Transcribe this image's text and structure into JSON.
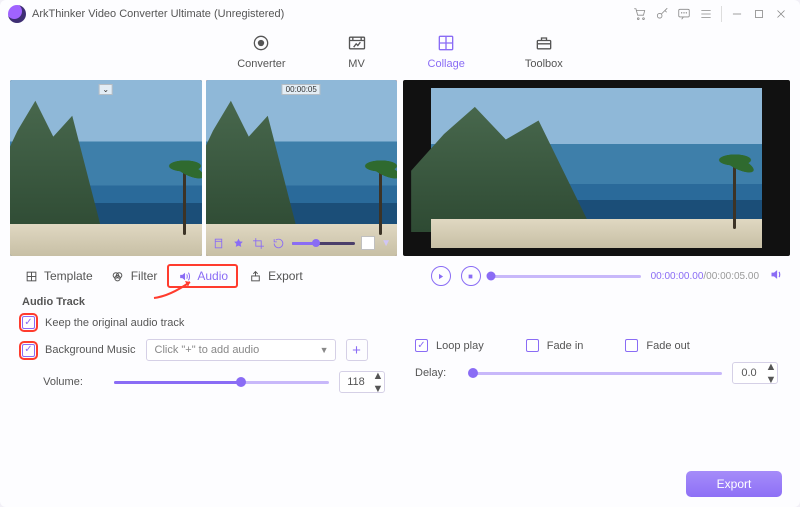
{
  "window": {
    "title": "ArkThinker Video Converter Ultimate (Unregistered)"
  },
  "nav": {
    "items": [
      {
        "label": "Converter"
      },
      {
        "label": "MV"
      },
      {
        "label": "Collage"
      },
      {
        "label": "Toolbox"
      }
    ],
    "active_index": 2
  },
  "editor": {
    "selected_clip_timestamp": "00:00:05"
  },
  "tabs": {
    "items": [
      {
        "label": "Template"
      },
      {
        "label": "Filter"
      },
      {
        "label": "Audio"
      },
      {
        "label": "Export"
      }
    ],
    "active_index": 2
  },
  "playback": {
    "current": "00:00:00.00",
    "total": "00:00:05.00"
  },
  "audio": {
    "heading": "Audio Track",
    "keep_original": {
      "label": "Keep the original audio track",
      "checked": true
    },
    "bg_music": {
      "label": "Background Music",
      "checked": true,
      "placeholder": "Click \"+\" to add audio"
    },
    "volume": {
      "label": "Volume:",
      "value": 118,
      "percent": 59
    },
    "loop": {
      "label": "Loop play",
      "checked": true
    },
    "fade_in": {
      "label": "Fade in",
      "checked": false
    },
    "fade_out": {
      "label": "Fade out",
      "checked": false
    },
    "delay": {
      "label": "Delay:",
      "value": "0.0",
      "percent": 0
    }
  },
  "footer": {
    "export_label": "Export"
  }
}
